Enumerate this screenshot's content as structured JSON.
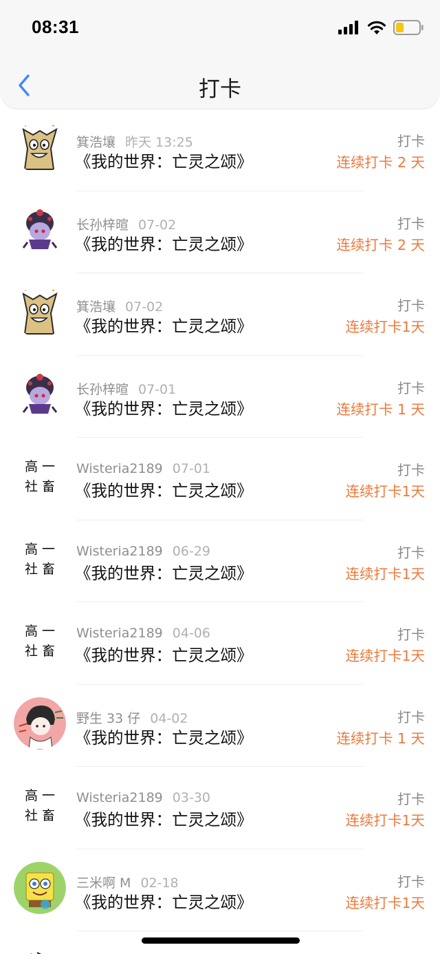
{
  "status_bar": {
    "time": "08:31"
  },
  "nav": {
    "title": "打卡"
  },
  "entries": [
    {
      "user": "箕浩壤",
      "date": "昨天 13:25",
      "book": "《我的世界：亡灵之颂》",
      "tag": "打卡",
      "streak": "连续打卡 2 天",
      "avatar": "beige-cartoon-avatar"
    },
    {
      "user": "长孙梓暄",
      "date": "07-02",
      "book": "《我的世界：亡灵之颂》",
      "tag": "打卡",
      "streak": "连续打卡 2 天",
      "avatar": "purple-chibi-avatar"
    },
    {
      "user": "箕浩壤",
      "date": "07-02",
      "book": "《我的世界：亡灵之颂》",
      "tag": "打卡",
      "streak": "连续打卡1天",
      "avatar": "beige-cartoon-avatar"
    },
    {
      "user": "长孙梓暄",
      "date": "07-01",
      "book": "《我的世界：亡灵之颂》",
      "tag": "打卡",
      "streak": "连续打卡 1 天",
      "avatar": "purple-chibi-avatar"
    },
    {
      "user": "Wisteria2189",
      "date": "07-01",
      "book": "《我的世界：亡灵之颂》",
      "tag": "打卡",
      "streak": "连续打卡1天",
      "avatar": "calligraphy-avatar"
    },
    {
      "user": "Wisteria2189",
      "date": "06-29",
      "book": "《我的世界：亡灵之颂》",
      "tag": "打卡",
      "streak": "连续打卡1天",
      "avatar": "calligraphy-avatar"
    },
    {
      "user": "Wisteria2189",
      "date": "04-06",
      "book": "《我的世界：亡灵之颂》",
      "tag": "打卡",
      "streak": "连续打卡1天",
      "avatar": "calligraphy-avatar"
    },
    {
      "user": "野生 33 仔",
      "date": "04-02",
      "book": "《我的世界：亡灵之颂》",
      "tag": "打卡",
      "streak": "连续打卡 1 天",
      "avatar": "pink-sketch-avatar"
    },
    {
      "user": "Wisteria2189",
      "date": "03-30",
      "book": "《我的世界：亡灵之颂》",
      "tag": "打卡",
      "streak": "连续打卡1天",
      "avatar": "calligraphy-avatar"
    },
    {
      "user": "三米啊 M",
      "date": "02-18",
      "book": "《我的世界：亡灵之颂》",
      "tag": "打卡",
      "streak": "连续打卡1天",
      "avatar": "sponge-cartoon-avatar"
    }
  ],
  "avatar_text": {
    "line1": "高 一",
    "line2": "社 畜"
  },
  "colors": {
    "accent": "#ed7a3d",
    "back": "#3d8af7",
    "username": "#8e8e8e",
    "date": "#b0b0b0"
  }
}
